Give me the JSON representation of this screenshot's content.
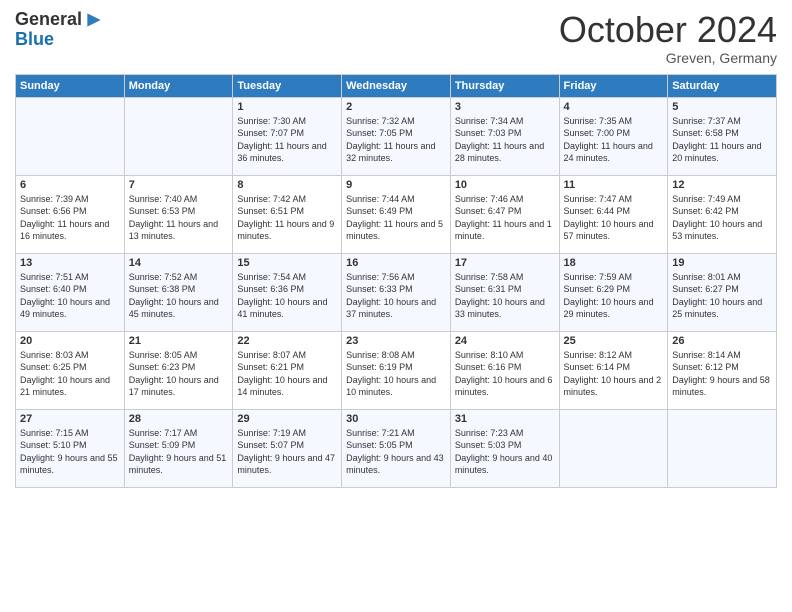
{
  "header": {
    "logo_general": "General",
    "logo_blue": "Blue",
    "month": "October 2024",
    "location": "Greven, Germany"
  },
  "days_of_week": [
    "Sunday",
    "Monday",
    "Tuesday",
    "Wednesday",
    "Thursday",
    "Friday",
    "Saturday"
  ],
  "weeks": [
    [
      {
        "day": "",
        "sunrise": "",
        "sunset": "",
        "daylight": ""
      },
      {
        "day": "",
        "sunrise": "",
        "sunset": "",
        "daylight": ""
      },
      {
        "day": "1",
        "sunrise": "Sunrise: 7:30 AM",
        "sunset": "Sunset: 7:07 PM",
        "daylight": "Daylight: 11 hours and 36 minutes."
      },
      {
        "day": "2",
        "sunrise": "Sunrise: 7:32 AM",
        "sunset": "Sunset: 7:05 PM",
        "daylight": "Daylight: 11 hours and 32 minutes."
      },
      {
        "day": "3",
        "sunrise": "Sunrise: 7:34 AM",
        "sunset": "Sunset: 7:03 PM",
        "daylight": "Daylight: 11 hours and 28 minutes."
      },
      {
        "day": "4",
        "sunrise": "Sunrise: 7:35 AM",
        "sunset": "Sunset: 7:00 PM",
        "daylight": "Daylight: 11 hours and 24 minutes."
      },
      {
        "day": "5",
        "sunrise": "Sunrise: 7:37 AM",
        "sunset": "Sunset: 6:58 PM",
        "daylight": "Daylight: 11 hours and 20 minutes."
      }
    ],
    [
      {
        "day": "6",
        "sunrise": "Sunrise: 7:39 AM",
        "sunset": "Sunset: 6:56 PM",
        "daylight": "Daylight: 11 hours and 16 minutes."
      },
      {
        "day": "7",
        "sunrise": "Sunrise: 7:40 AM",
        "sunset": "Sunset: 6:53 PM",
        "daylight": "Daylight: 11 hours and 13 minutes."
      },
      {
        "day": "8",
        "sunrise": "Sunrise: 7:42 AM",
        "sunset": "Sunset: 6:51 PM",
        "daylight": "Daylight: 11 hours and 9 minutes."
      },
      {
        "day": "9",
        "sunrise": "Sunrise: 7:44 AM",
        "sunset": "Sunset: 6:49 PM",
        "daylight": "Daylight: 11 hours and 5 minutes."
      },
      {
        "day": "10",
        "sunrise": "Sunrise: 7:46 AM",
        "sunset": "Sunset: 6:47 PM",
        "daylight": "Daylight: 11 hours and 1 minute."
      },
      {
        "day": "11",
        "sunrise": "Sunrise: 7:47 AM",
        "sunset": "Sunset: 6:44 PM",
        "daylight": "Daylight: 10 hours and 57 minutes."
      },
      {
        "day": "12",
        "sunrise": "Sunrise: 7:49 AM",
        "sunset": "Sunset: 6:42 PM",
        "daylight": "Daylight: 10 hours and 53 minutes."
      }
    ],
    [
      {
        "day": "13",
        "sunrise": "Sunrise: 7:51 AM",
        "sunset": "Sunset: 6:40 PM",
        "daylight": "Daylight: 10 hours and 49 minutes."
      },
      {
        "day": "14",
        "sunrise": "Sunrise: 7:52 AM",
        "sunset": "Sunset: 6:38 PM",
        "daylight": "Daylight: 10 hours and 45 minutes."
      },
      {
        "day": "15",
        "sunrise": "Sunrise: 7:54 AM",
        "sunset": "Sunset: 6:36 PM",
        "daylight": "Daylight: 10 hours and 41 minutes."
      },
      {
        "day": "16",
        "sunrise": "Sunrise: 7:56 AM",
        "sunset": "Sunset: 6:33 PM",
        "daylight": "Daylight: 10 hours and 37 minutes."
      },
      {
        "day": "17",
        "sunrise": "Sunrise: 7:58 AM",
        "sunset": "Sunset: 6:31 PM",
        "daylight": "Daylight: 10 hours and 33 minutes."
      },
      {
        "day": "18",
        "sunrise": "Sunrise: 7:59 AM",
        "sunset": "Sunset: 6:29 PM",
        "daylight": "Daylight: 10 hours and 29 minutes."
      },
      {
        "day": "19",
        "sunrise": "Sunrise: 8:01 AM",
        "sunset": "Sunset: 6:27 PM",
        "daylight": "Daylight: 10 hours and 25 minutes."
      }
    ],
    [
      {
        "day": "20",
        "sunrise": "Sunrise: 8:03 AM",
        "sunset": "Sunset: 6:25 PM",
        "daylight": "Daylight: 10 hours and 21 minutes."
      },
      {
        "day": "21",
        "sunrise": "Sunrise: 8:05 AM",
        "sunset": "Sunset: 6:23 PM",
        "daylight": "Daylight: 10 hours and 17 minutes."
      },
      {
        "day": "22",
        "sunrise": "Sunrise: 8:07 AM",
        "sunset": "Sunset: 6:21 PM",
        "daylight": "Daylight: 10 hours and 14 minutes."
      },
      {
        "day": "23",
        "sunrise": "Sunrise: 8:08 AM",
        "sunset": "Sunset: 6:19 PM",
        "daylight": "Daylight: 10 hours and 10 minutes."
      },
      {
        "day": "24",
        "sunrise": "Sunrise: 8:10 AM",
        "sunset": "Sunset: 6:16 PM",
        "daylight": "Daylight: 10 hours and 6 minutes."
      },
      {
        "day": "25",
        "sunrise": "Sunrise: 8:12 AM",
        "sunset": "Sunset: 6:14 PM",
        "daylight": "Daylight: 10 hours and 2 minutes."
      },
      {
        "day": "26",
        "sunrise": "Sunrise: 8:14 AM",
        "sunset": "Sunset: 6:12 PM",
        "daylight": "Daylight: 9 hours and 58 minutes."
      }
    ],
    [
      {
        "day": "27",
        "sunrise": "Sunrise: 7:15 AM",
        "sunset": "Sunset: 5:10 PM",
        "daylight": "Daylight: 9 hours and 55 minutes."
      },
      {
        "day": "28",
        "sunrise": "Sunrise: 7:17 AM",
        "sunset": "Sunset: 5:09 PM",
        "daylight": "Daylight: 9 hours and 51 minutes."
      },
      {
        "day": "29",
        "sunrise": "Sunrise: 7:19 AM",
        "sunset": "Sunset: 5:07 PM",
        "daylight": "Daylight: 9 hours and 47 minutes."
      },
      {
        "day": "30",
        "sunrise": "Sunrise: 7:21 AM",
        "sunset": "Sunset: 5:05 PM",
        "daylight": "Daylight: 9 hours and 43 minutes."
      },
      {
        "day": "31",
        "sunrise": "Sunrise: 7:23 AM",
        "sunset": "Sunset: 5:03 PM",
        "daylight": "Daylight: 9 hours and 40 minutes."
      },
      {
        "day": "",
        "sunrise": "",
        "sunset": "",
        "daylight": ""
      },
      {
        "day": "",
        "sunrise": "",
        "sunset": "",
        "daylight": ""
      }
    ]
  ]
}
